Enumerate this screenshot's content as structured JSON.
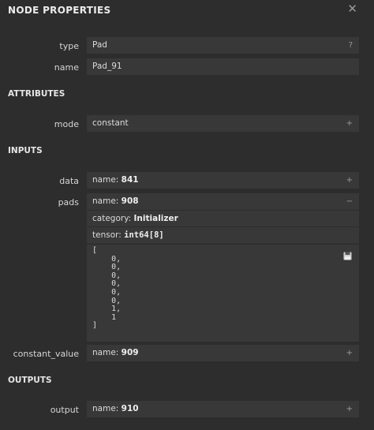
{
  "header": {
    "title": "NODE PROPERTIES",
    "close_label": "✕"
  },
  "node": {
    "type_label": "type",
    "type_value": "Pad",
    "type_btn": "?",
    "name_label": "name",
    "name_value": "Pad_91"
  },
  "attributes": {
    "heading": "ATTRIBUTES",
    "mode_label": "mode",
    "mode_value": "constant",
    "mode_btn": "+"
  },
  "inputs": {
    "heading": "INPUTS",
    "data_label": "data",
    "data_name_prefix": "name: ",
    "data_name_value": "841",
    "data_btn": "+",
    "pads_label": "pads",
    "pads_name_prefix": "name: ",
    "pads_name_value": "908",
    "pads_btn": "−",
    "pads_category_prefix": "category: ",
    "pads_category_value": "Initializer",
    "pads_tensor_prefix": "tensor: ",
    "pads_tensor_value": "int64[8]",
    "pads_values": "[\n    0,\n    0,\n    0,\n    0,\n    0,\n    0,\n    1,\n    1\n]",
    "cv_label": "constant_value",
    "cv_name_prefix": "name: ",
    "cv_name_value": "909",
    "cv_btn": "+"
  },
  "outputs": {
    "heading": "OUTPUTS",
    "output_label": "output",
    "output_name_prefix": "name: ",
    "output_name_value": "910",
    "output_btn": "+"
  }
}
